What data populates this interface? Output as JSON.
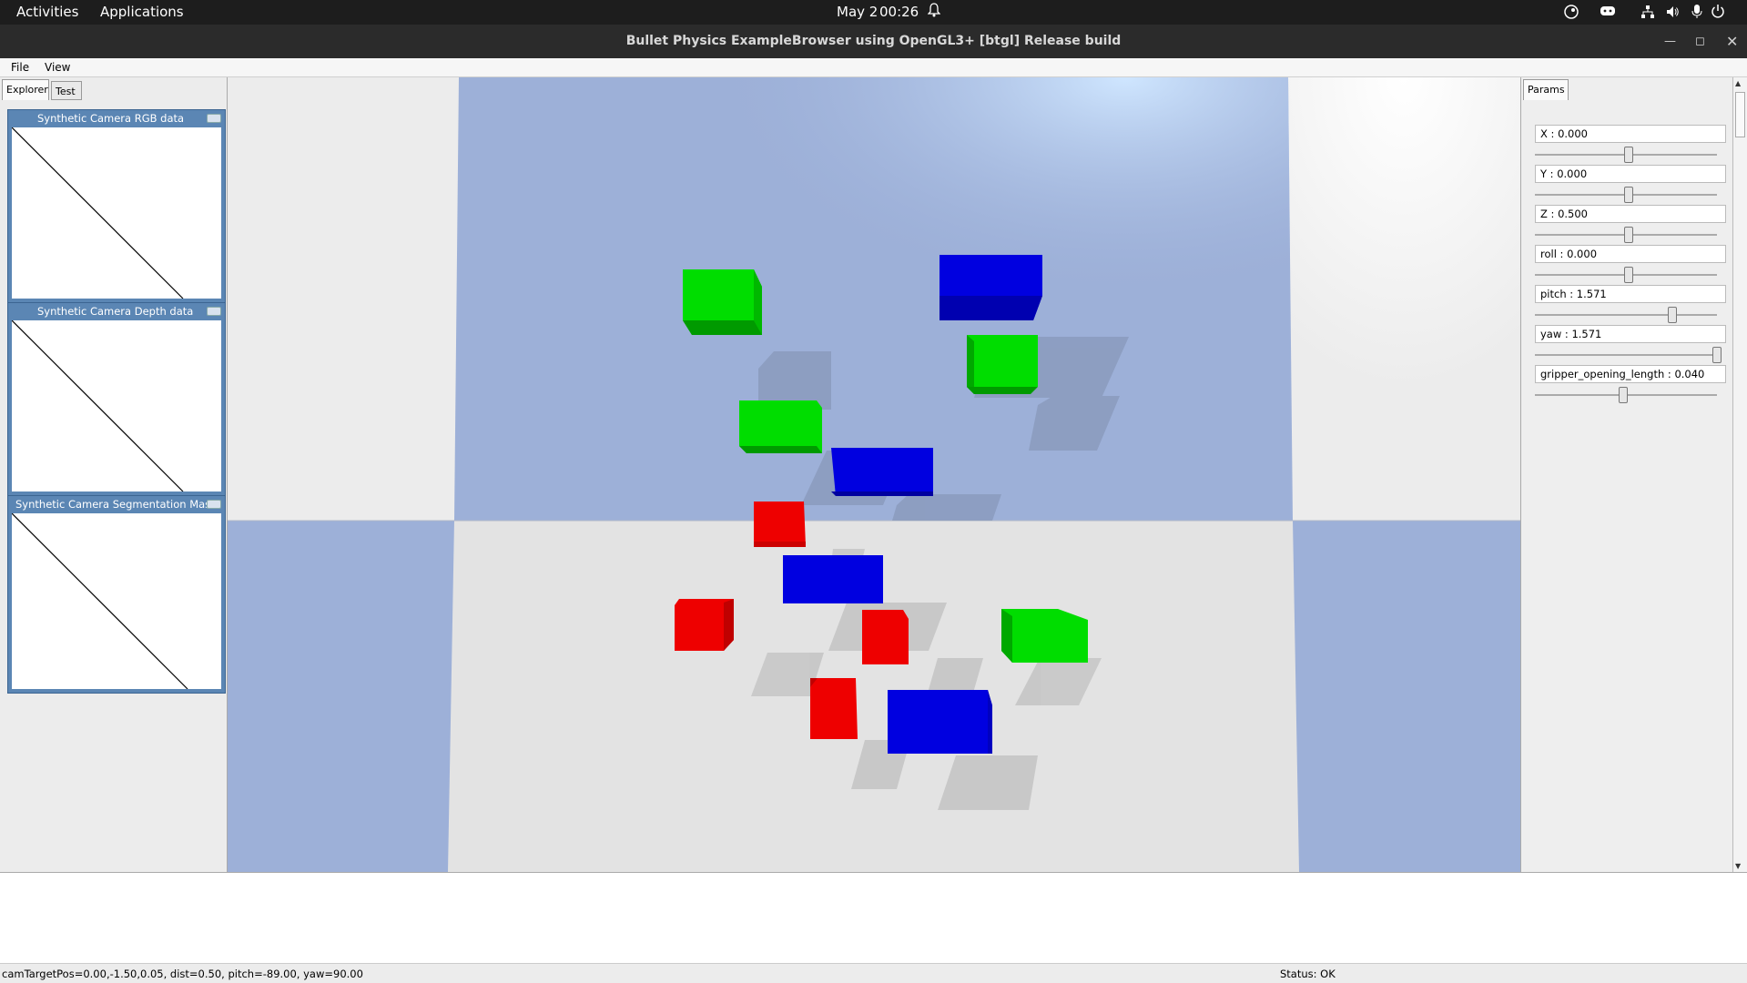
{
  "topbar": {
    "activities": "Activities",
    "applications": "Applications",
    "date": "May 2",
    "time": "00:26"
  },
  "window": {
    "title": "Bullet Physics ExampleBrowser using OpenGL3+ [btgl] Release build"
  },
  "menu": {
    "file": "File",
    "view": "View"
  },
  "left_tabs": {
    "explorer": "Explorer",
    "test": "Test"
  },
  "camera_windows": [
    {
      "title": "Synthetic Camera RGB data"
    },
    {
      "title": "Synthetic Camera Depth data"
    },
    {
      "title": "Synthetic Camera Segmentation Mask"
    }
  ],
  "params": {
    "tab": "Params",
    "sliders": [
      {
        "label": "X : 0.000",
        "fraction": 0.5
      },
      {
        "label": "Y : 0.000",
        "fraction": 0.5
      },
      {
        "label": "Z : 0.500",
        "fraction": 0.5
      },
      {
        "label": "roll : 0.000",
        "fraction": 0.5
      },
      {
        "label": "pitch : 1.571",
        "fraction": 0.75
      },
      {
        "label": "yaw : 1.571",
        "fraction": 1.0
      },
      {
        "label": "gripper_opening_length : 0.040",
        "fraction": 0.47
      }
    ]
  },
  "status": {
    "left": "camTargetPos=0.00,-1.50,0.05, dist=0.50, pitch=-89.00, yaw=90.00",
    "right": "Status: OK"
  },
  "scene": {
    "colors": {
      "red": "#ff0000",
      "green": "#00dd00",
      "blue": "#0000e0",
      "plane_blue": "#9db0d8",
      "plane_grey": "#e3e3e3"
    }
  }
}
